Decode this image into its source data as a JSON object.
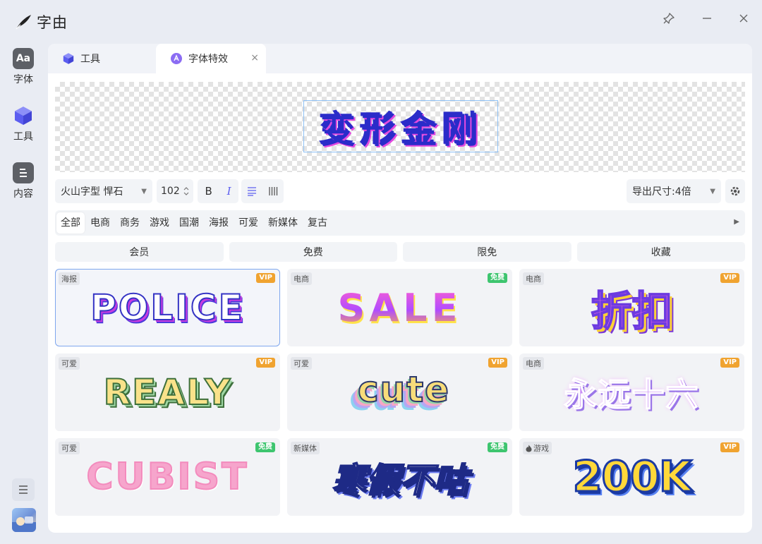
{
  "app": {
    "title": "字由"
  },
  "sidebar": {
    "items": [
      {
        "label": "字体",
        "icon": "font-aa-icon"
      },
      {
        "label": "工具",
        "icon": "cube-icon"
      },
      {
        "label": "内容",
        "icon": "document-icon"
      }
    ]
  },
  "tabs": [
    {
      "label": "工具",
      "icon": "cube-icon"
    },
    {
      "label": "字体特效",
      "icon": "effect-icon",
      "close": "×"
    }
  ],
  "canvas": {
    "text": "变形金刚"
  },
  "toolbar": {
    "font": "火山字型 悍石",
    "size": "102",
    "bold": "B",
    "italic": "I",
    "export": "导出尺寸:4倍"
  },
  "categories": [
    "全部",
    "电商",
    "商务",
    "游戏",
    "国潮",
    "海报",
    "可爱",
    "新媒体",
    "复古"
  ],
  "filters": [
    "会员",
    "免费",
    "限免",
    "收藏"
  ],
  "cards": [
    {
      "tag": "海报",
      "badge": "VIP",
      "text": "POLICE"
    },
    {
      "tag": "电商",
      "badge": "免费",
      "text": "SALE"
    },
    {
      "tag": "电商",
      "badge": "VIP",
      "text": "折扣"
    },
    {
      "tag": "可爱",
      "badge": "VIP",
      "text": "REALY"
    },
    {
      "tag": "可爱",
      "badge": "VIP",
      "text": "cute"
    },
    {
      "tag": "电商",
      "badge": "VIP",
      "text": "永远十六"
    },
    {
      "tag": "可爱",
      "badge": "免费",
      "text": "CUBIST"
    },
    {
      "tag": "新媒体",
      "badge": "免费",
      "text": "寒假不咕"
    },
    {
      "tag": "游戏",
      "badge": "VIP",
      "text": "200K"
    }
  ],
  "colors": {
    "accent": "#6b6cf6",
    "vip": "#f0a330",
    "free": "#3ec56f",
    "selection": "#8fc1f5"
  }
}
